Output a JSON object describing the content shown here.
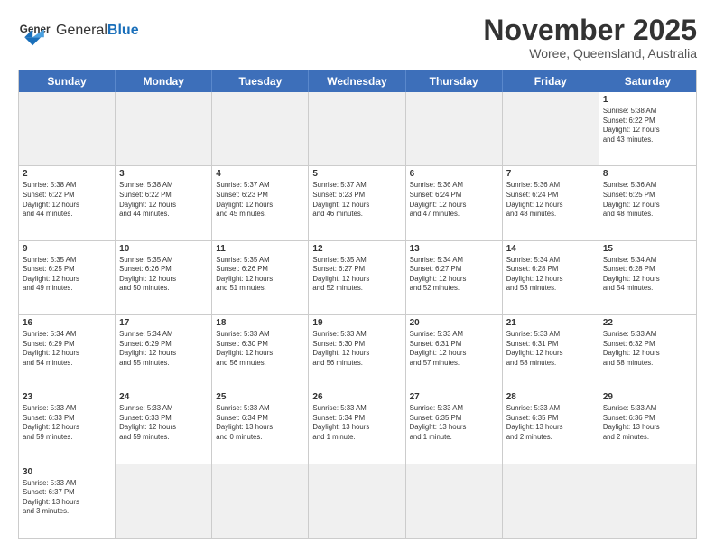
{
  "logo": {
    "text_normal": "General",
    "text_bold": "Blue"
  },
  "title": "November 2025",
  "subtitle": "Woree, Queensland, Australia",
  "header_days": [
    "Sunday",
    "Monday",
    "Tuesday",
    "Wednesday",
    "Thursday",
    "Friday",
    "Saturday"
  ],
  "rows": [
    [
      {
        "day": "",
        "info": "",
        "empty": true
      },
      {
        "day": "",
        "info": "",
        "empty": true
      },
      {
        "day": "",
        "info": "",
        "empty": true
      },
      {
        "day": "",
        "info": "",
        "empty": true
      },
      {
        "day": "",
        "info": "",
        "empty": true
      },
      {
        "day": "",
        "info": "",
        "empty": true
      },
      {
        "day": "1",
        "info": "Sunrise: 5:38 AM\nSunset: 6:22 PM\nDaylight: 12 hours\nand 43 minutes.",
        "empty": false
      }
    ],
    [
      {
        "day": "2",
        "info": "Sunrise: 5:38 AM\nSunset: 6:22 PM\nDaylight: 12 hours\nand 44 minutes.",
        "empty": false
      },
      {
        "day": "3",
        "info": "Sunrise: 5:38 AM\nSunset: 6:22 PM\nDaylight: 12 hours\nand 44 minutes.",
        "empty": false
      },
      {
        "day": "4",
        "info": "Sunrise: 5:37 AM\nSunset: 6:23 PM\nDaylight: 12 hours\nand 45 minutes.",
        "empty": false
      },
      {
        "day": "5",
        "info": "Sunrise: 5:37 AM\nSunset: 6:23 PM\nDaylight: 12 hours\nand 46 minutes.",
        "empty": false
      },
      {
        "day": "6",
        "info": "Sunrise: 5:36 AM\nSunset: 6:24 PM\nDaylight: 12 hours\nand 47 minutes.",
        "empty": false
      },
      {
        "day": "7",
        "info": "Sunrise: 5:36 AM\nSunset: 6:24 PM\nDaylight: 12 hours\nand 48 minutes.",
        "empty": false
      },
      {
        "day": "8",
        "info": "Sunrise: 5:36 AM\nSunset: 6:25 PM\nDaylight: 12 hours\nand 48 minutes.",
        "empty": false
      }
    ],
    [
      {
        "day": "9",
        "info": "Sunrise: 5:35 AM\nSunset: 6:25 PM\nDaylight: 12 hours\nand 49 minutes.",
        "empty": false
      },
      {
        "day": "10",
        "info": "Sunrise: 5:35 AM\nSunset: 6:26 PM\nDaylight: 12 hours\nand 50 minutes.",
        "empty": false
      },
      {
        "day": "11",
        "info": "Sunrise: 5:35 AM\nSunset: 6:26 PM\nDaylight: 12 hours\nand 51 minutes.",
        "empty": false
      },
      {
        "day": "12",
        "info": "Sunrise: 5:35 AM\nSunset: 6:27 PM\nDaylight: 12 hours\nand 52 minutes.",
        "empty": false
      },
      {
        "day": "13",
        "info": "Sunrise: 5:34 AM\nSunset: 6:27 PM\nDaylight: 12 hours\nand 52 minutes.",
        "empty": false
      },
      {
        "day": "14",
        "info": "Sunrise: 5:34 AM\nSunset: 6:28 PM\nDaylight: 12 hours\nand 53 minutes.",
        "empty": false
      },
      {
        "day": "15",
        "info": "Sunrise: 5:34 AM\nSunset: 6:28 PM\nDaylight: 12 hours\nand 54 minutes.",
        "empty": false
      }
    ],
    [
      {
        "day": "16",
        "info": "Sunrise: 5:34 AM\nSunset: 6:29 PM\nDaylight: 12 hours\nand 54 minutes.",
        "empty": false
      },
      {
        "day": "17",
        "info": "Sunrise: 5:34 AM\nSunset: 6:29 PM\nDaylight: 12 hours\nand 55 minutes.",
        "empty": false
      },
      {
        "day": "18",
        "info": "Sunrise: 5:33 AM\nSunset: 6:30 PM\nDaylight: 12 hours\nand 56 minutes.",
        "empty": false
      },
      {
        "day": "19",
        "info": "Sunrise: 5:33 AM\nSunset: 6:30 PM\nDaylight: 12 hours\nand 56 minutes.",
        "empty": false
      },
      {
        "day": "20",
        "info": "Sunrise: 5:33 AM\nSunset: 6:31 PM\nDaylight: 12 hours\nand 57 minutes.",
        "empty": false
      },
      {
        "day": "21",
        "info": "Sunrise: 5:33 AM\nSunset: 6:31 PM\nDaylight: 12 hours\nand 58 minutes.",
        "empty": false
      },
      {
        "day": "22",
        "info": "Sunrise: 5:33 AM\nSunset: 6:32 PM\nDaylight: 12 hours\nand 58 minutes.",
        "empty": false
      }
    ],
    [
      {
        "day": "23",
        "info": "Sunrise: 5:33 AM\nSunset: 6:33 PM\nDaylight: 12 hours\nand 59 minutes.",
        "empty": false
      },
      {
        "day": "24",
        "info": "Sunrise: 5:33 AM\nSunset: 6:33 PM\nDaylight: 12 hours\nand 59 minutes.",
        "empty": false
      },
      {
        "day": "25",
        "info": "Sunrise: 5:33 AM\nSunset: 6:34 PM\nDaylight: 13 hours\nand 0 minutes.",
        "empty": false
      },
      {
        "day": "26",
        "info": "Sunrise: 5:33 AM\nSunset: 6:34 PM\nDaylight: 13 hours\nand 1 minute.",
        "empty": false
      },
      {
        "day": "27",
        "info": "Sunrise: 5:33 AM\nSunset: 6:35 PM\nDaylight: 13 hours\nand 1 minute.",
        "empty": false
      },
      {
        "day": "28",
        "info": "Sunrise: 5:33 AM\nSunset: 6:35 PM\nDaylight: 13 hours\nand 2 minutes.",
        "empty": false
      },
      {
        "day": "29",
        "info": "Sunrise: 5:33 AM\nSunset: 6:36 PM\nDaylight: 13 hours\nand 2 minutes.",
        "empty": false
      }
    ],
    [
      {
        "day": "30",
        "info": "Sunrise: 5:33 AM\nSunset: 6:37 PM\nDaylight: 13 hours\nand 3 minutes.",
        "empty": false
      },
      {
        "day": "",
        "info": "",
        "empty": true
      },
      {
        "day": "",
        "info": "",
        "empty": true
      },
      {
        "day": "",
        "info": "",
        "empty": true
      },
      {
        "day": "",
        "info": "",
        "empty": true
      },
      {
        "day": "",
        "info": "",
        "empty": true
      },
      {
        "day": "",
        "info": "",
        "empty": true
      }
    ]
  ]
}
